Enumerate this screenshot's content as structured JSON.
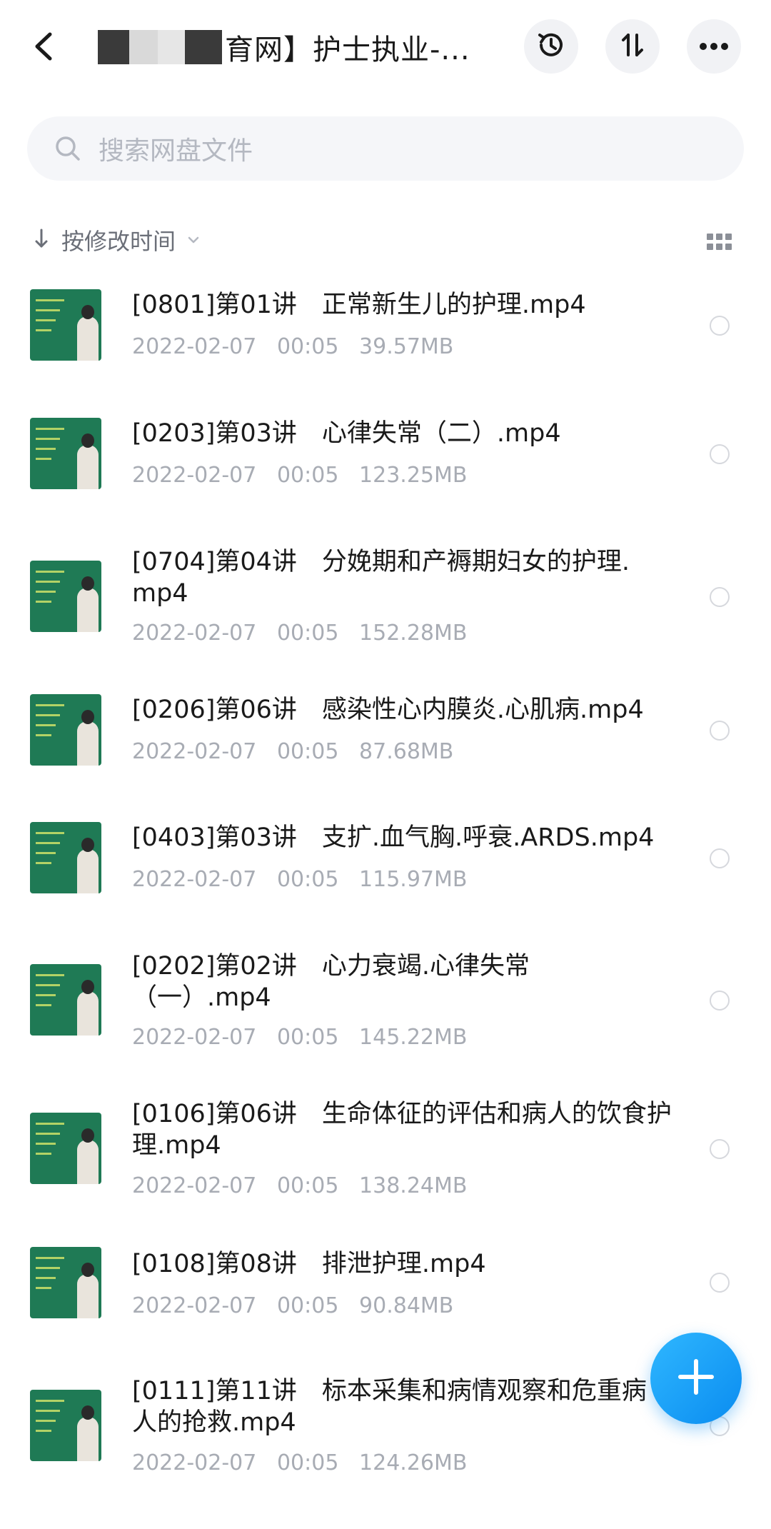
{
  "header": {
    "title": "育网】护士执业-...",
    "history_icon": "history-clock-icon",
    "sort_icon": "sort-order-icon",
    "more_icon": "more-dots-icon"
  },
  "search": {
    "placeholder": "搜索网盘文件"
  },
  "sort": {
    "label": "按修改时间"
  },
  "files": [
    {
      "name": "[0801]第01讲　正常新生儿的护理.mp4",
      "meta": "2022-02-07   00:05   39.57MB"
    },
    {
      "name": "[0203]第03讲　心律失常（二）.mp4",
      "meta": "2022-02-07   00:05   123.25MB"
    },
    {
      "name": "[0704]第04讲　分娩期和产褥期妇女的护理.mp4",
      "meta": "2022-02-07   00:05   152.28MB"
    },
    {
      "name": "[0206]第06讲　感染性心内膜炎.心肌病.mp4",
      "meta": "2022-02-07   00:05   87.68MB"
    },
    {
      "name": "[0403]第03讲　支扩.血气胸.呼衰.ARDS.mp4",
      "meta": "2022-02-07   00:05   115.97MB"
    },
    {
      "name": "[0202]第02讲　心力衰竭.心律失常（一）.mp4",
      "meta": "2022-02-07   00:05   145.22MB"
    },
    {
      "name": "[0106]第06讲　生命体征的评估和病人的饮食护理.mp4",
      "meta": "2022-02-07   00:05   138.24MB"
    },
    {
      "name": "[0108]第08讲　排泄护理.mp4",
      "meta": "2022-02-07   00:05   90.84MB"
    },
    {
      "name": "[0111]第11讲　标本采集和病情观察和危重病人的抢救.mp4",
      "meta": "2022-02-07   00:05   124.26MB"
    }
  ],
  "colors": {
    "accent": "#0a8cf0",
    "thumb_board": "#1f7a55",
    "meta_text": "#a8acb4"
  }
}
